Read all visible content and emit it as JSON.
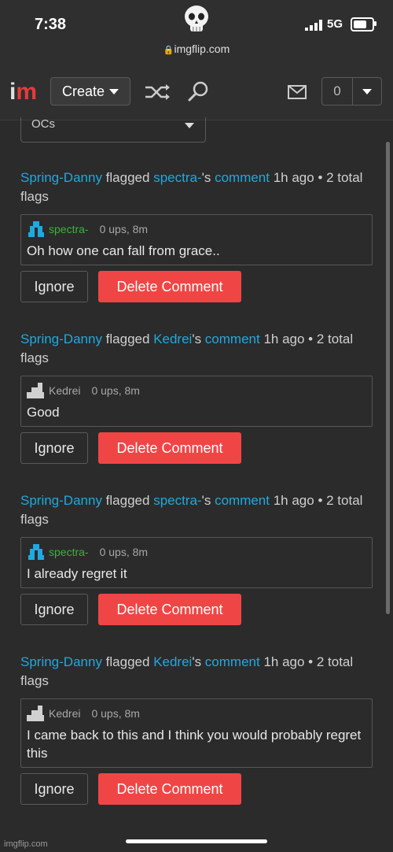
{
  "status": {
    "time": "7:38",
    "network": "5G"
  },
  "browser": {
    "url": "imgflip.com"
  },
  "nav": {
    "logo_i": "i",
    "logo_m": "m",
    "create_label": "Create",
    "notif_count": "0"
  },
  "filter": {
    "selected": "OCs"
  },
  "flags": [
    {
      "flagger": "Spring-Danny",
      "verb": " flagged ",
      "target": "spectra-",
      "possessive": "'s ",
      "comment_link": "comment",
      "time": " 1h ago • 2 total flags",
      "user": "spectra-",
      "meta": "0 ups, 8m",
      "text": "Oh how one can fall from grace..",
      "ignore": "Ignore",
      "delete": "Delete Comment"
    },
    {
      "flagger": "Spring-Danny",
      "verb": " flagged ",
      "target": "Kedrei",
      "possessive": "'s ",
      "comment_link": "comment",
      "time": " 1h ago • 2 total flags",
      "user": "Kedrei",
      "meta": "0 ups, 8m",
      "text": "Good",
      "ignore": "Ignore",
      "delete": "Delete Comment"
    },
    {
      "flagger": "Spring-Danny",
      "verb": " flagged ",
      "target": "spectra-",
      "possessive": "'s ",
      "comment_link": "comment",
      "time": " 1h ago • 2 total flags",
      "user": "spectra-",
      "meta": "0 ups, 8m",
      "text": "I already regret it",
      "ignore": "Ignore",
      "delete": "Delete Comment"
    },
    {
      "flagger": "Spring-Danny",
      "verb": " flagged ",
      "target": "Kedrei",
      "possessive": "'s ",
      "comment_link": "comment",
      "time": " 1h ago • 2 total flags",
      "user": "Kedrei",
      "meta": "0 ups, 8m",
      "text": "I came back to this and I think you would probably regret this",
      "ignore": "Ignore",
      "delete": "Delete Comment"
    }
  ],
  "footer": {
    "watermark": "imgflip.com"
  },
  "colors": {
    "link": "#1fa9e0",
    "delete": "#f04545",
    "green_user": "#3bb33b",
    "logo_red": "#e63b3b"
  }
}
